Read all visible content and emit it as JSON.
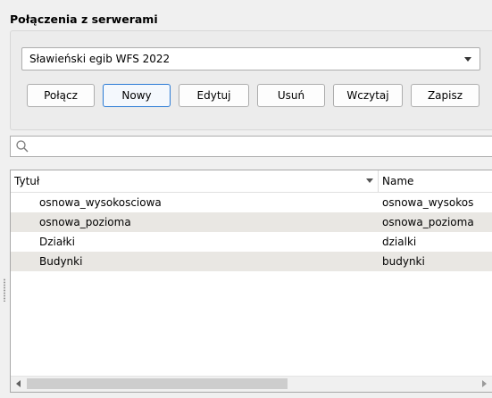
{
  "section": {
    "title": "Połączenia z serwerami"
  },
  "connection": {
    "selected": "Sławieński egib WFS 2022"
  },
  "buttons": {
    "connect": "Połącz",
    "new": "Nowy",
    "edit": "Edytuj",
    "remove": "Usuń",
    "load": "Wczytaj",
    "save": "Zapisz"
  },
  "search": {
    "value": "",
    "placeholder": ""
  },
  "table": {
    "columns": [
      "Tytuł",
      "Name"
    ],
    "rows": [
      [
        "osnowa_wysokosciowa",
        "osnowa_wysokos"
      ],
      [
        "osnowa_pozioma",
        "osnowa_pozioma"
      ],
      [
        "Działki",
        "dzialki"
      ],
      [
        "Budynki",
        "budynki"
      ]
    ]
  },
  "colors": {
    "focus_border": "#2a7ad5",
    "alt_row": "#e9e7e3",
    "panel_bg": "#f0f0f0"
  }
}
